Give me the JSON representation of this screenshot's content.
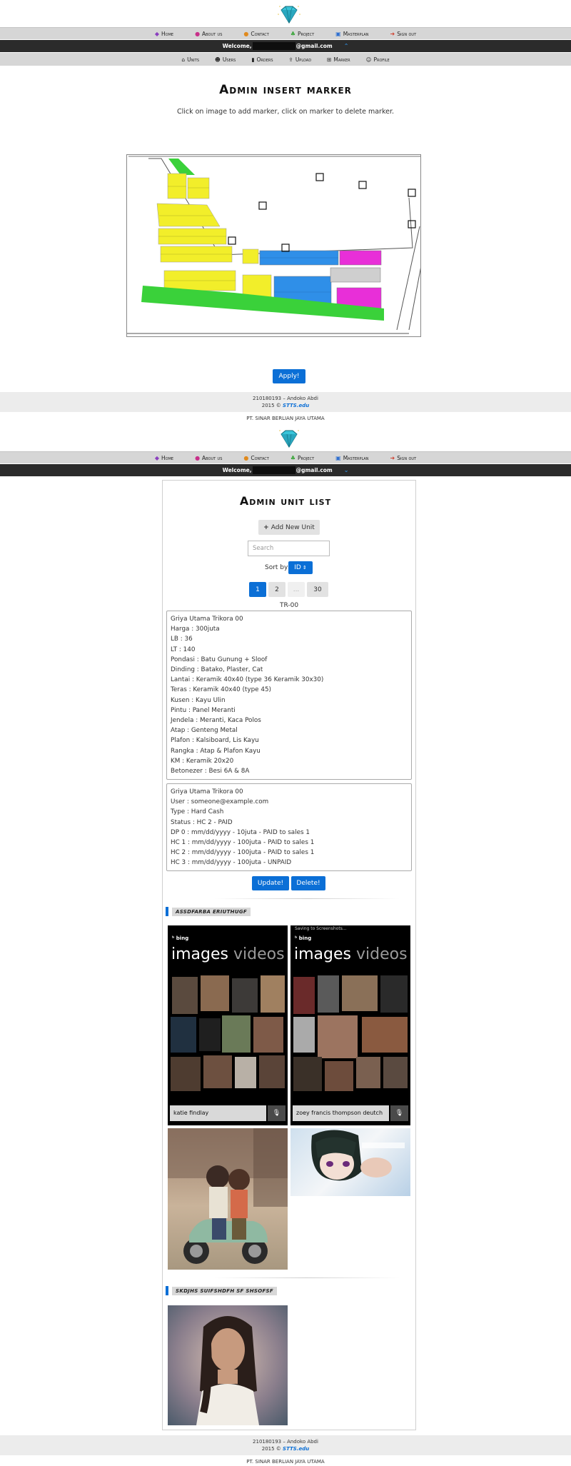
{
  "nav": {
    "items": [
      {
        "label": "Home",
        "icon": "diamond-icon",
        "color": "#8b3fbf"
      },
      {
        "label": "About us",
        "icon": "info-icon",
        "color": "#c8308a"
      },
      {
        "label": "Contact",
        "icon": "contact-icon",
        "color": "#e08a1e"
      },
      {
        "label": "Project",
        "icon": "project-icon",
        "color": "#3aa53a"
      },
      {
        "label": "Masterplan",
        "icon": "masterplan-icon",
        "color": "#2f6fd0"
      },
      {
        "label": "Sign out",
        "icon": "sign-out-icon",
        "color": "#d0402f"
      }
    ]
  },
  "welcome": {
    "prefix": "Welcome,",
    "suffix": "@gmail.com"
  },
  "admin_nav": {
    "items": [
      {
        "label": "Units",
        "icon": "home-icon"
      },
      {
        "label": "Users",
        "icon": "users-icon"
      },
      {
        "label": "Orders",
        "icon": "bookmark-icon"
      },
      {
        "label": "Upload",
        "icon": "upload-icon"
      },
      {
        "label": "Marker",
        "icon": "plus-square-icon"
      },
      {
        "label": "Profile",
        "icon": "user-icon"
      }
    ]
  },
  "marker_page": {
    "title": "Admin insert marker",
    "subtitle": "Click on image to add marker, click on marker to delete marker.",
    "apply_label": "Apply!"
  },
  "footer": {
    "line1": "210180193 – Andoko Abdi",
    "line2_prefix": "2015 ©",
    "stts": "STTS.edu",
    "company": "PT. SINAR BERLIAN JAYA UTAMA"
  },
  "unit_page": {
    "title": "Admin unit list",
    "add_label": "Add New Unit",
    "search_placeholder": "Search",
    "sort_label": "Sort by",
    "sort_value": "ID",
    "pages": [
      "1",
      "2",
      "...",
      "30"
    ],
    "unit_code": "TR-00",
    "spec_lines": [
      "Griya Utama Trikora 00",
      "Harga : 300juta",
      "LB : 36",
      "LT : 140",
      "Pondasi : Batu Gunung + Sloof",
      "Dinding : Batako, Plaster, Cat",
      "Lantai : Keramik 40x40 (type 36 Keramik 30x30)",
      "Teras : Keramik 40x40 (type 45)",
      "Kusen : Kayu Ulin",
      "Pintu : Panel Meranti",
      "Jendela : Meranti, Kaca Polos",
      "Atap : Genteng Metal",
      "Plafon : Kalsiboard, Lis Kayu",
      "Rangka : Atap & Plafon Kayu",
      "KM : Keramik 20x20",
      "Betonezer : Besi 6A & 8A"
    ],
    "order_lines": [
      "Griya Utama Trikora 00",
      "User : someone@example.com",
      "Type : Hard Cash",
      "Status : HC 2 - PAID",
      "DP 0 : mm/dd/yyyy - 10juta - PAID to sales 1",
      "HC 1 : mm/dd/yyyy - 100juta - PAID to sales 1",
      "HC 2 : mm/dd/yyyy - 100juta - PAID to sales 1",
      "HC 3 : mm/dd/yyyy - 100juta - UNPAID"
    ],
    "update_label": "Update!",
    "delete_label": "Delete!",
    "section1": "ASSDFARBA ERIUTHUGF",
    "section2": "SKDJHS SUIFSHDFH SF SHSOFSF",
    "phone1": {
      "bing": "bing",
      "images": "images",
      "videos": "videos",
      "query": "katie findlay"
    },
    "phone2": {
      "saving": "Saving to Screenshots...",
      "bing": "bing",
      "images": "images",
      "videos": "videos",
      "query": "zoey francis thompson deutch"
    }
  }
}
